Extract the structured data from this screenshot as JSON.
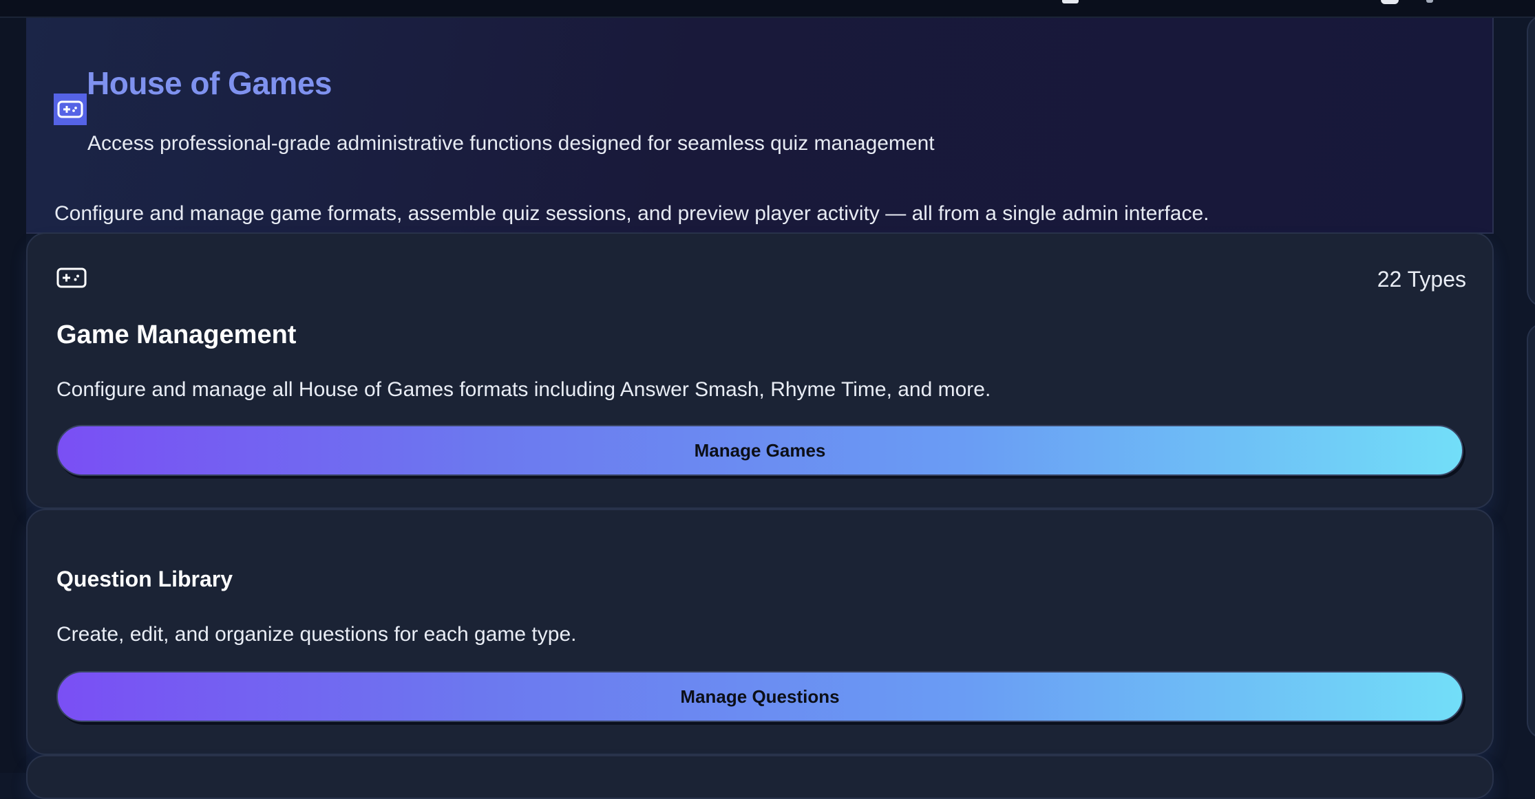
{
  "hero": {
    "title": "House of Games",
    "subtitle": "Access professional-grade administrative functions designed for seamless quiz management",
    "description": "Configure and manage game formats, assemble quiz sessions, and preview player activity — all from a single admin interface.",
    "icon": "gamepad-icon"
  },
  "cards": {
    "game": {
      "icon": "gamepad-icon",
      "badge": "22 Types",
      "title": "Game Management",
      "description": "Configure and manage all House of Games formats including Answer Smash, Rhyme Time, and more.",
      "button_label": "Manage Games"
    },
    "questions": {
      "title": "Question Library",
      "description": "Create, edit, and organize questions for each game type.",
      "button_label": "Manage Questions"
    }
  },
  "colors": {
    "accent_title": "#7f92ef",
    "icon_bg": "#5563e6",
    "button_gradient_start": "#7a4ff4",
    "button_gradient_end": "#72def8",
    "card_bg": "#1b2335"
  }
}
